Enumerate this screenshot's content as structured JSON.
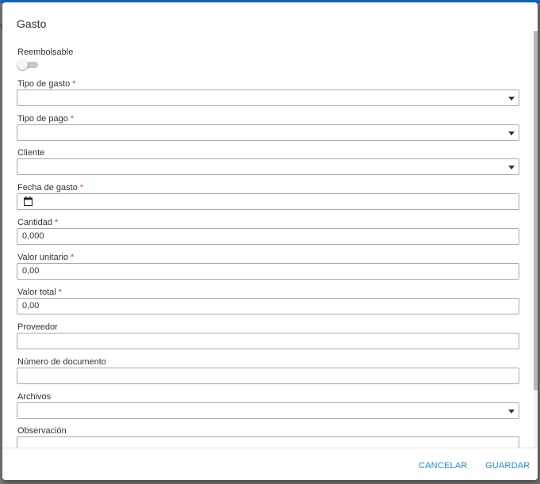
{
  "background": {
    "glyph": "v"
  },
  "dialog": {
    "title": "Gasto",
    "reimbursable": {
      "label": "Reembolsable",
      "checked": false
    },
    "required_marker": "*",
    "fields": {
      "tipo_gasto": {
        "label": "Tipo de gasto",
        "value": ""
      },
      "tipo_pago": {
        "label": "Tipo de pago",
        "value": ""
      },
      "cliente": {
        "label": "Cliente",
        "value": ""
      },
      "fecha_gasto": {
        "label": "Fecha de gasto",
        "value": "",
        "icon": "calendar-icon"
      },
      "cantidad": {
        "label": "Cantidad",
        "value": "0,000"
      },
      "valor_unitario": {
        "label": "Valor unitario",
        "value": "0,00"
      },
      "valor_total": {
        "label": "Valor total",
        "value": "0,00"
      },
      "proveedor": {
        "label": "Proveedor",
        "value": ""
      },
      "numero_documento": {
        "label": "Número de documento",
        "value": ""
      },
      "archivos": {
        "label": "Archivos",
        "value": ""
      },
      "observacion": {
        "label": "Observación",
        "value": ""
      }
    },
    "footer": {
      "cancel_label": "CANCELAR",
      "save_label": "GUARDAR"
    }
  },
  "colors": {
    "accent": "#1e88e5",
    "required": "#e53935",
    "topbar": "#1565c0"
  }
}
